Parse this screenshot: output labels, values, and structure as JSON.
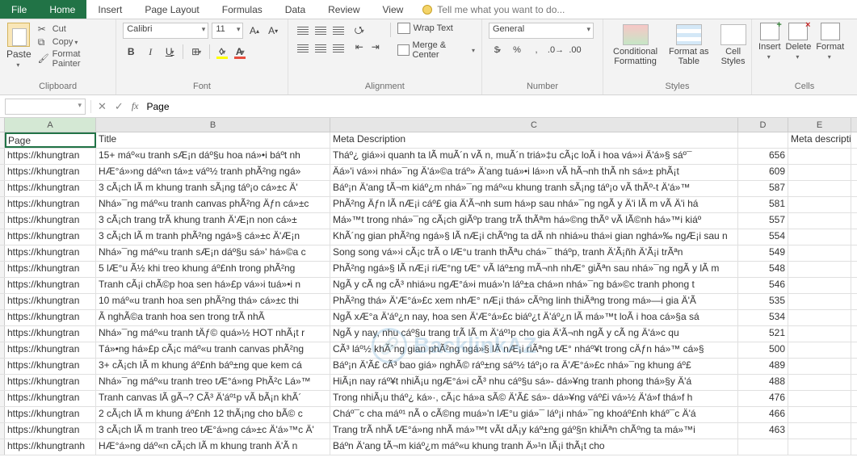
{
  "tabs": {
    "file": "File",
    "home": "Home",
    "insert": "Insert",
    "page_layout": "Page Layout",
    "formulas": "Formulas",
    "data": "Data",
    "review": "Review",
    "view": "View",
    "tell_me": "Tell me what you want to do..."
  },
  "ribbon": {
    "clipboard": {
      "paste": "Paste",
      "cut": "Cut",
      "copy": "Copy",
      "format_painter": "Format Painter",
      "label": "Clipboard"
    },
    "font": {
      "name": "Calibri",
      "size": "11",
      "label": "Font"
    },
    "alignment": {
      "wrap": "Wrap Text",
      "merge": "Merge & Center",
      "label": "Alignment"
    },
    "number": {
      "format": "General",
      "label": "Number"
    },
    "styles": {
      "cond": "Conditional\nFormatting",
      "table": "Format as\nTable",
      "cell": "Cell\nStyles",
      "label": "Styles"
    },
    "cells": {
      "insert": "Insert",
      "delete": "Delete",
      "format": "Format",
      "label": "Cells"
    }
  },
  "formula_bar": {
    "name_box": "",
    "fx": "fx",
    "value": "Page"
  },
  "columns": {
    "A": "A",
    "B": "B",
    "C": "C",
    "D": "D",
    "E": "E"
  },
  "headers": {
    "A": "Page",
    "B": "Title",
    "C": "Meta Description",
    "D": "",
    "E": "Meta description length"
  },
  "rows": [
    {
      "A": "https://khungtran",
      "B": "15+ máº«u tranh sÆ¡n dáº§u hoa ná»•i báº­t nh",
      "C": "Tháº¿ giá»›i quanh ta lÃ  muÃ´n vÃ n, muÃ´n triá»‡u cÃ¡c loÃ i hoa vá»›i Ä'á»§ sáº¯",
      "D": "656",
      "E": ""
    },
    {
      "A": "https://khungtran",
      "B": "HÆ°á»›ng dáº«n tá»± váº½ tranh phÃ²ng ngá»",
      "C": "Äá»'i vá»›i nhá»¯ng Ä'á»©a tráº» Ä'ang tuá»•i lá»›n vÃ  hÃ¬nh thÃ nh sá»± phÃ¡t",
      "D": "609",
      "E": ""
    },
    {
      "A": "https://khungtran",
      "B": "3 cÃ¡ch lÃ m khung tranh sÃ¡ng táº¡o cá»±c Ä'",
      "C": "Báº¡n Ä'ang tÃ¬m kiáº¿m nhá»¯ng máº«u khung tranh sÃ¡ng táº¡o vÃ  thÃº-t Ä'á»™",
      "D": "587",
      "E": ""
    },
    {
      "A": "https://khungtran",
      "B": "Nhá»¯ng máº«u tranh canvas phÃ²ng Äƒn cá»±c",
      "C": "PhÃ²ng Äƒn lÃ  nÆ¡i cáº£ gia Ä'Ã¬nh sum há»p sau nhá»¯ng ngÃ y Ä'i lÃ m vÃ  Ä'i há",
      "D": "581",
      "E": ""
    },
    {
      "A": "https://khungtran",
      "B": "3 cÃ¡ch trang trÃ­ khung tranh Ä'Æ¡n non cá»±",
      "C": "Má»™t trong nhá»¯ng cÃ¡ch giÃºp trang trÃ­ thÃªm há»©ng thÃº vÃ  lÃ©nh há»™i kiáº",
      "D": "557",
      "E": ""
    },
    {
      "A": "https://khungtran",
      "B": "3 cÃ¡ch lÃ m tranh phÃ²ng ngá»§ cá»±c Ä'Æ¡n",
      "C": "KhÃ´ng gian phÃ²ng ngá»§ lÃ  nÆ¡i chÃºng ta dÃ nh nhiá»u thá»i gian nghá»‰ ngÆ¡i sau n",
      "D": "554",
      "E": ""
    },
    {
      "A": "https://khungtran",
      "B": "Nhá»¯ng máº«u tranh sÆ¡n dáº§u sá»' há»©a c",
      "C": "Song song vá»›i cÃ¡c trÃ o lÆ°u tranh thÃªu chá»¯ tháº­p, tranh Ä'Ã¡ñh Ä'Ã¡i trÃªn",
      "D": "549",
      "E": ""
    },
    {
      "A": "https://khungtran",
      "B": "5 lÆ°u Ã½ khi treo khung áº£nh trong phÃ²ng",
      "C": "PhÃ²ng ngá»§ lÃ  nÆ¡i riÆ°ng tÆ° vÃ  láº±ng mÃ¬nh nhÆ° giÃªn sau nhá»¯ng ngÃ y lÃ m",
      "D": "548",
      "E": ""
    },
    {
      "A": "https://khungtran",
      "B": "Tranh cÃ¡i chÃ©p hoa sen há»£p vá»›i tuá»•i n",
      "C": "NgÃ y cÃ ng cÃ³ nhiá»u ngÆ°á»i muá»'n láº±a chá»n nhá»¯ng bá»©c tranh phong t",
      "D": "546",
      "E": ""
    },
    {
      "A": "https://khungtran",
      "B": "10 máº«u tranh hoa sen phÃ²ng thá» cá»±c thi",
      "C": "PhÃ²ng thá» Ä'Æ°á»£c xem nhÆ° nÆ¡i thá» cÃºng linh thiÃªng trong má»—i gia Ä'Ã",
      "D": "535",
      "E": ""
    },
    {
      "A": "https://khungtran",
      "B": "Ã nghÃ©a tranh hoa sen trong trÃ­ nhÃ",
      "C": "NgÃ xÆ°a Ä'áº¿n nay, hoa sen Ä'Æ°á»£c biáº¿t Ä'áº¿n lÃ  má»™t loÃ i hoa cá»§a sá",
      "D": "534",
      "E": ""
    },
    {
      "A": "https://khungtran",
      "B": "Nhá»¯ng máº«u tranh tÄƒ© quá»½ HOT nhÃ¡t r",
      "C": "NgÃ y nay, nhu cáº§u trang trÃ­ lÃ m Ä'áº¹p cho gia Ä'Ã¬nh ngÃ y cÃ ng Ä'á»c qu",
      "D": "521",
      "E": ""
    },
    {
      "A": "https://khungtran",
      "B": "Tá»•ng há»£p cÃ¡c máº«u tranh canvas phÃ²ng",
      "C": "CÃ³ láº½ khÃ´ng gian phÃ²ng ngá»§ lÃ  nÆ¡i riÃªng tÆ° nháº¥t trong cÄƒn há»™ cá»§",
      "D": "500",
      "E": ""
    },
    {
      "A": "https://khungtran",
      "B": "3+ cÃ¡ch lÃ m khung áº£nh báº±ng que kem cá",
      "C": "Báº¡n Ä'Ã£ cÃ³ bao giá» nghÃ© ráº±ng sáº½ táº¡o ra Ä'Æ°á»£c nhá»¯ng khung áº£",
      "D": "489",
      "E": ""
    },
    {
      "A": "https://khungtran",
      "B": "Nhá»¯ng máº«u tranh treo tÆ°á»ng PhÃ²c Lá»™",
      "C": "HiÃ¡n nay ráº¥t nhiÃ¡u ngÆ°á»i cÃ³ nhu cáº§u sá»- dá»¥ng tranh phong thá»§y Ä'á",
      "D": "488",
      "E": ""
    },
    {
      "A": "https://khungtran",
      "B": "Tranh canvas lÃ  gÃ¬? CÃ³ Ä'áº¹p vÃ  bÃ¡n khÃ´",
      "C": "Trong nhiÃ¡u tháº¿ ká»·, cÃ¡c há»a sÃ© Ä'Ã£ sá»- dá»¥ng váº£i vá»½ Ä'á»f thá»f h",
      "D": "476",
      "E": ""
    },
    {
      "A": "https://khungtran",
      "B": "2 cÃ¡ch lÃ m khung áº£nh 12 thÃ¡ng cho bÃ© c",
      "C": "Cháº¯c cha máº¹ nÃ o cÃ©ng muá»'n lÆ°u giá»¯ láº¡i nhá»¯ng khoáº£nh kháº¯c Ä'á",
      "D": "466",
      "E": ""
    },
    {
      "A": "https://khungtran",
      "B": "3 cÃ¡ch lÃ m tranh treo tÆ°á»ng cá»±c Ä'á»™c Ä'",
      "C": "Trang trÃ­ nhÃ  tÆ°á»ng nhÃ  má»™t vÃ­t dÃ¡y káº±ng gáº§n khiÃªn chÃºng ta má»™i",
      "D": "463",
      "E": ""
    },
    {
      "A": "https://khungtranh",
      "B": "HÆ°á»ng dáº«n cÃ¡ch lÃ m khung tranh Ä'Ã n",
      "C": "Báºn Ä'ang tÃ¬m kiáº¿m máº«u khung tranh Ä»¹n lÃ¡i thÃ¡t cho",
      "D": "",
      "E": ""
    }
  ],
  "watermark": "BacklinkAZ"
}
